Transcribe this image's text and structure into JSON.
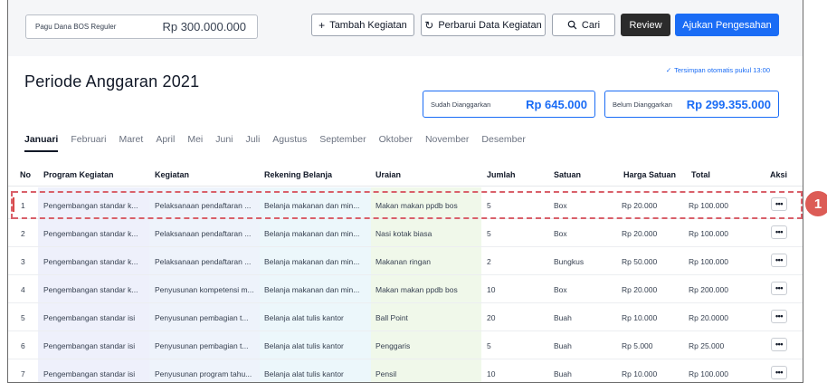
{
  "toolbar": {
    "pagu_label": "Pagu Dana BOS Reguler",
    "pagu_value": "Rp 300.000.000",
    "add_button": "Tambah Kegiatan",
    "refresh_button": "Perbarui Data Kegiatan",
    "search_button": "Cari",
    "review_button": "Review",
    "submit_button": "Ajukan Pengesahan",
    "icons": {
      "add": "plus-icon",
      "refresh": "refresh-icon",
      "search": "search-icon"
    }
  },
  "header": {
    "saved_status": "Tersimpan otomatis pukul 13:00",
    "title": "Periode Anggaran 2021",
    "budgeted_label": "Sudah Dianggarkan",
    "budgeted_value": "Rp 645.000",
    "unbudgeted_label": "Belum Dianggarkan",
    "unbudgeted_value": "Rp 299.355.000"
  },
  "tabs": [
    "Januari",
    "Februari",
    "Maret",
    "April",
    "Mei",
    "Juni",
    "Juli",
    "Agustus",
    "September",
    "Oktober",
    "November",
    "Desember"
  ],
  "active_tab": "Januari",
  "table": {
    "columns": [
      "No",
      "Program Kegiatan",
      "Kegiatan",
      "Rekening Belanja",
      "Uraian",
      "Jumlah",
      "Satuan",
      "Harga Satuan",
      "Total",
      "Aksi"
    ],
    "rows": [
      [
        "1",
        "Pengembangan standar k...",
        "Pelaksanaan pendaftaran ...",
        "Belanja makanan dan min...",
        "Makan makan ppdb bos",
        "5",
        "Box",
        "Rp 20.000",
        "Rp 100.000"
      ],
      [
        "2",
        "Pengembangan standar k...",
        "Pelaksanaan pendaftaran ...",
        "Belanja makanan dan min...",
        "Nasi kotak biasa",
        "5",
        "Box",
        "Rp 20.000",
        "Rp 100.000"
      ],
      [
        "3",
        "Pengembangan standar k...",
        "Pelaksanaan pendaftaran ...",
        "Belanja makanan dan min...",
        "Makanan ringan",
        "2",
        "Bungkus",
        "Rp 50.000",
        "Rp 100.000"
      ],
      [
        "4",
        "Pengembangan standar k...",
        "Penyusunan kompetensi m...",
        "Belanja makanan dan min...",
        "Makan makan ppdb bos",
        "10",
        "Box",
        "Rp 20.000",
        "Rp 200.000"
      ],
      [
        "5",
        "Pengembangan standar isi",
        "Penyusunan pembagian t...",
        "Belanja alat tulis kantor",
        "Ball Point",
        "20",
        "Buah",
        "Rp 10.000",
        "Rp 20.0000"
      ],
      [
        "6",
        "Pengembangan standar isi",
        "Penyusunan pembagian t...",
        "Belanja alat tulis kantor",
        "Penggaris",
        "5",
        "Buah",
        "Rp 5.000",
        "Rp 25.000"
      ],
      [
        "7",
        "Pengembangan standar isi",
        "Penyusunan program tahu...",
        "Belanja alat tulis kantor",
        "Pensil",
        "10",
        "Buah",
        "Rp 10.000",
        "Rp 100.000"
      ]
    ],
    "action_icon": "more-horizontal-icon"
  },
  "annotation": {
    "badge": "1",
    "highlighted_row": 1
  },
  "colors": {
    "accent": "#1a6cf5",
    "highlight": "#d9606a",
    "badge": "#dc5c56"
  }
}
